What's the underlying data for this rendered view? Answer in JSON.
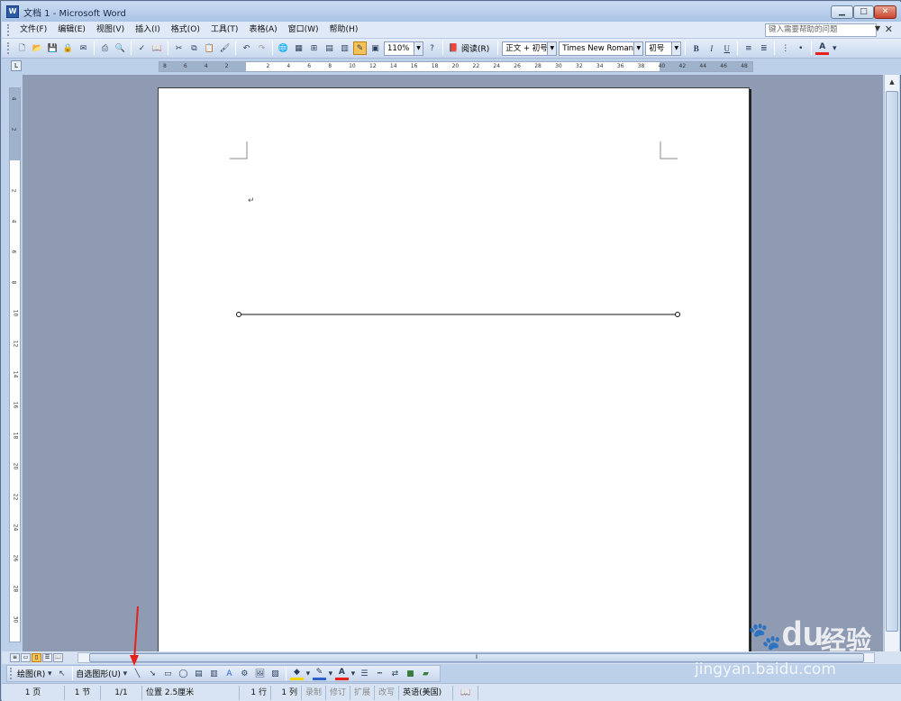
{
  "window": {
    "title": "文档 1 - Microsoft Word",
    "app_icon": "W"
  },
  "menu": [
    "文件(F)",
    "编辑(E)",
    "视图(V)",
    "插入(I)",
    "格式(O)",
    "工具(T)",
    "表格(A)",
    "窗口(W)",
    "帮助(H)"
  ],
  "help": {
    "placeholder": "键入需要帮助的问题"
  },
  "toolbar": {
    "zoom": "110%",
    "read_label": "阅读(R)",
    "style": "正文 + 初号",
    "font": "Times New Roman",
    "size": "初号",
    "bold": "B",
    "italic": "I",
    "underline": "U",
    "font_color": "A"
  },
  "ruler": {
    "h_ticks": [
      "8",
      "6",
      "4",
      "2",
      "",
      "2",
      "4",
      "6",
      "8",
      "10",
      "12",
      "14",
      "16",
      "18",
      "20",
      "22",
      "24",
      "26",
      "28",
      "30",
      "32",
      "34",
      "36",
      "38",
      "40",
      "42",
      "44",
      "46",
      "48"
    ],
    "v_ticks": [
      "4",
      "2",
      "",
      "2",
      "4",
      "6",
      "8",
      "10",
      "12",
      "14",
      "16",
      "18",
      "20",
      "22",
      "24",
      "26",
      "28",
      "30"
    ],
    "corner": "L"
  },
  "document": {
    "paragraph_mark": "↵"
  },
  "drawing": {
    "draw_label": "绘图(R)",
    "autoshape_label": "自选图形(U)"
  },
  "status": {
    "page": "1 页",
    "section": "1 节",
    "pages": "1/1",
    "position": "位置 2.5厘米",
    "line": "1 行",
    "col": "1 列",
    "rec": "录制",
    "trk": "修订",
    "ext": "扩展",
    "ovr": "改写",
    "lang": "英语(美国)"
  },
  "watermark": {
    "brand": "Bai",
    "brand2": "du",
    "cn": "经验",
    "url": "jingyan.baidu.com"
  },
  "colors": {
    "accent": "#e8201c",
    "title_bar": "#bcd0ea"
  }
}
